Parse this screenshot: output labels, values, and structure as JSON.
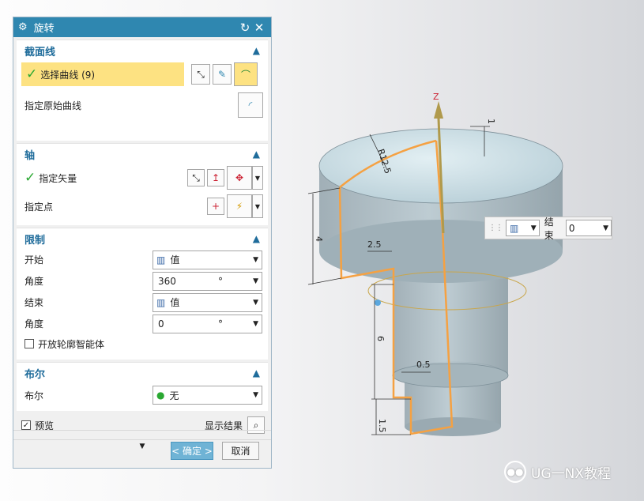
{
  "dialog": {
    "title": "旋转",
    "section_curve": {
      "title": "截面线",
      "select_label": "选择曲线 (9)",
      "origin_label": "指定原始曲线"
    },
    "section_axis": {
      "title": "轴",
      "vector_label": "指定矢量",
      "point_label": "指定点"
    },
    "section_limit": {
      "title": "限制",
      "start_label": "开始",
      "start_value": "值",
      "angle1_label": "角度",
      "angle1_value": "360",
      "angle1_unit": "°",
      "end_label": "结束",
      "end_value": "值",
      "angle2_label": "角度",
      "angle2_value": "0",
      "angle2_unit": "°",
      "open_label": "开放轮廓智能体"
    },
    "section_bool": {
      "title": "布尔",
      "bool_label": "布尔",
      "bool_value": "无"
    },
    "preview_label": "预览",
    "show_result_label": "显示结果",
    "ok_label": "< 确定 >",
    "cancel_label": "取消"
  },
  "floating": {
    "end_label": "结束",
    "end_value": "0"
  },
  "viewport": {
    "axis_label": "Z",
    "dims": {
      "r": "R12.5",
      "top": "1",
      "h4": "4",
      "w25": "2.5",
      "h6": "6",
      "w05": "0.5",
      "h15": "1.5"
    }
  },
  "watermark": "UG一NX教程",
  "colors": {
    "title": "#2f87b0",
    "highlight": "#fde282",
    "profile": "#f5a142"
  }
}
